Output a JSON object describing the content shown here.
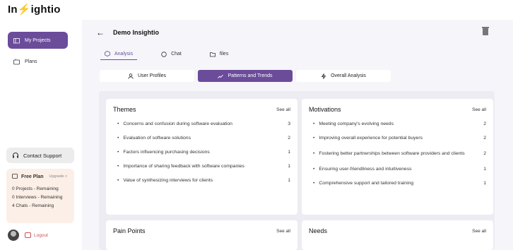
{
  "app": {
    "logo_prefix": "In",
    "logo_suffix": "ightio"
  },
  "sidebar": {
    "items": [
      {
        "label": "My Projects"
      },
      {
        "label": "Plans"
      }
    ],
    "support_label": "Contact Support",
    "plan": {
      "title": "Free Plan",
      "upgrade": "Upgrade >",
      "lines": [
        "0 Projects - Remaining",
        "0 Interviews - Remaining",
        "4 Chats - Remaining"
      ]
    },
    "logout_label": "Logout"
  },
  "header": {
    "title": "Demo Insightio"
  },
  "tabs": [
    {
      "label": "Analysis"
    },
    {
      "label": "Chat"
    },
    {
      "label": "files"
    }
  ],
  "views": [
    {
      "label": "User Profiles"
    },
    {
      "label": "Patterns and Trends"
    },
    {
      "label": "Overall Analysis"
    }
  ],
  "cards": {
    "themes": {
      "title": "Themes",
      "see_all": "See all",
      "rows": [
        {
          "text": "Concerns and confusion during software evaluation",
          "count": "3"
        },
        {
          "text": "Evaluation of software solutions",
          "count": "2"
        },
        {
          "text": "Factors influencing purchasing decisions",
          "count": "1"
        },
        {
          "text": "Importance of sharing feedback with software companies",
          "count": "1"
        },
        {
          "text": "Value of synthesizing interviews for clients",
          "count": "1"
        }
      ]
    },
    "motivations": {
      "title": "Motivations",
      "see_all": "See all",
      "rows": [
        {
          "text": "Meeting company's evolving needs",
          "count": "2"
        },
        {
          "text": "Improving overall experience for potential buyers",
          "count": "2"
        },
        {
          "text": "Fostering better partnerships between software providers and clients",
          "count": "2"
        },
        {
          "text": "Ensuring user-friendliness and intuitiveness",
          "count": "1"
        },
        {
          "text": "Comprehensive support and tailored training",
          "count": "1"
        }
      ]
    },
    "pain_points": {
      "title": "Pain Points",
      "see_all": "See all"
    },
    "needs": {
      "title": "Needs",
      "see_all": "See all"
    }
  },
  "colors": {
    "accent": "#6b4c9a",
    "logout": "#d05050",
    "plan_bg": "#fcefe7"
  },
  "icons": [
    "back-arrow-icon",
    "trash-icon",
    "folder-icon",
    "chat-icon",
    "cube-icon",
    "user-icon",
    "trend-icon",
    "bolt-icon",
    "headset-icon",
    "logout-icon"
  ]
}
